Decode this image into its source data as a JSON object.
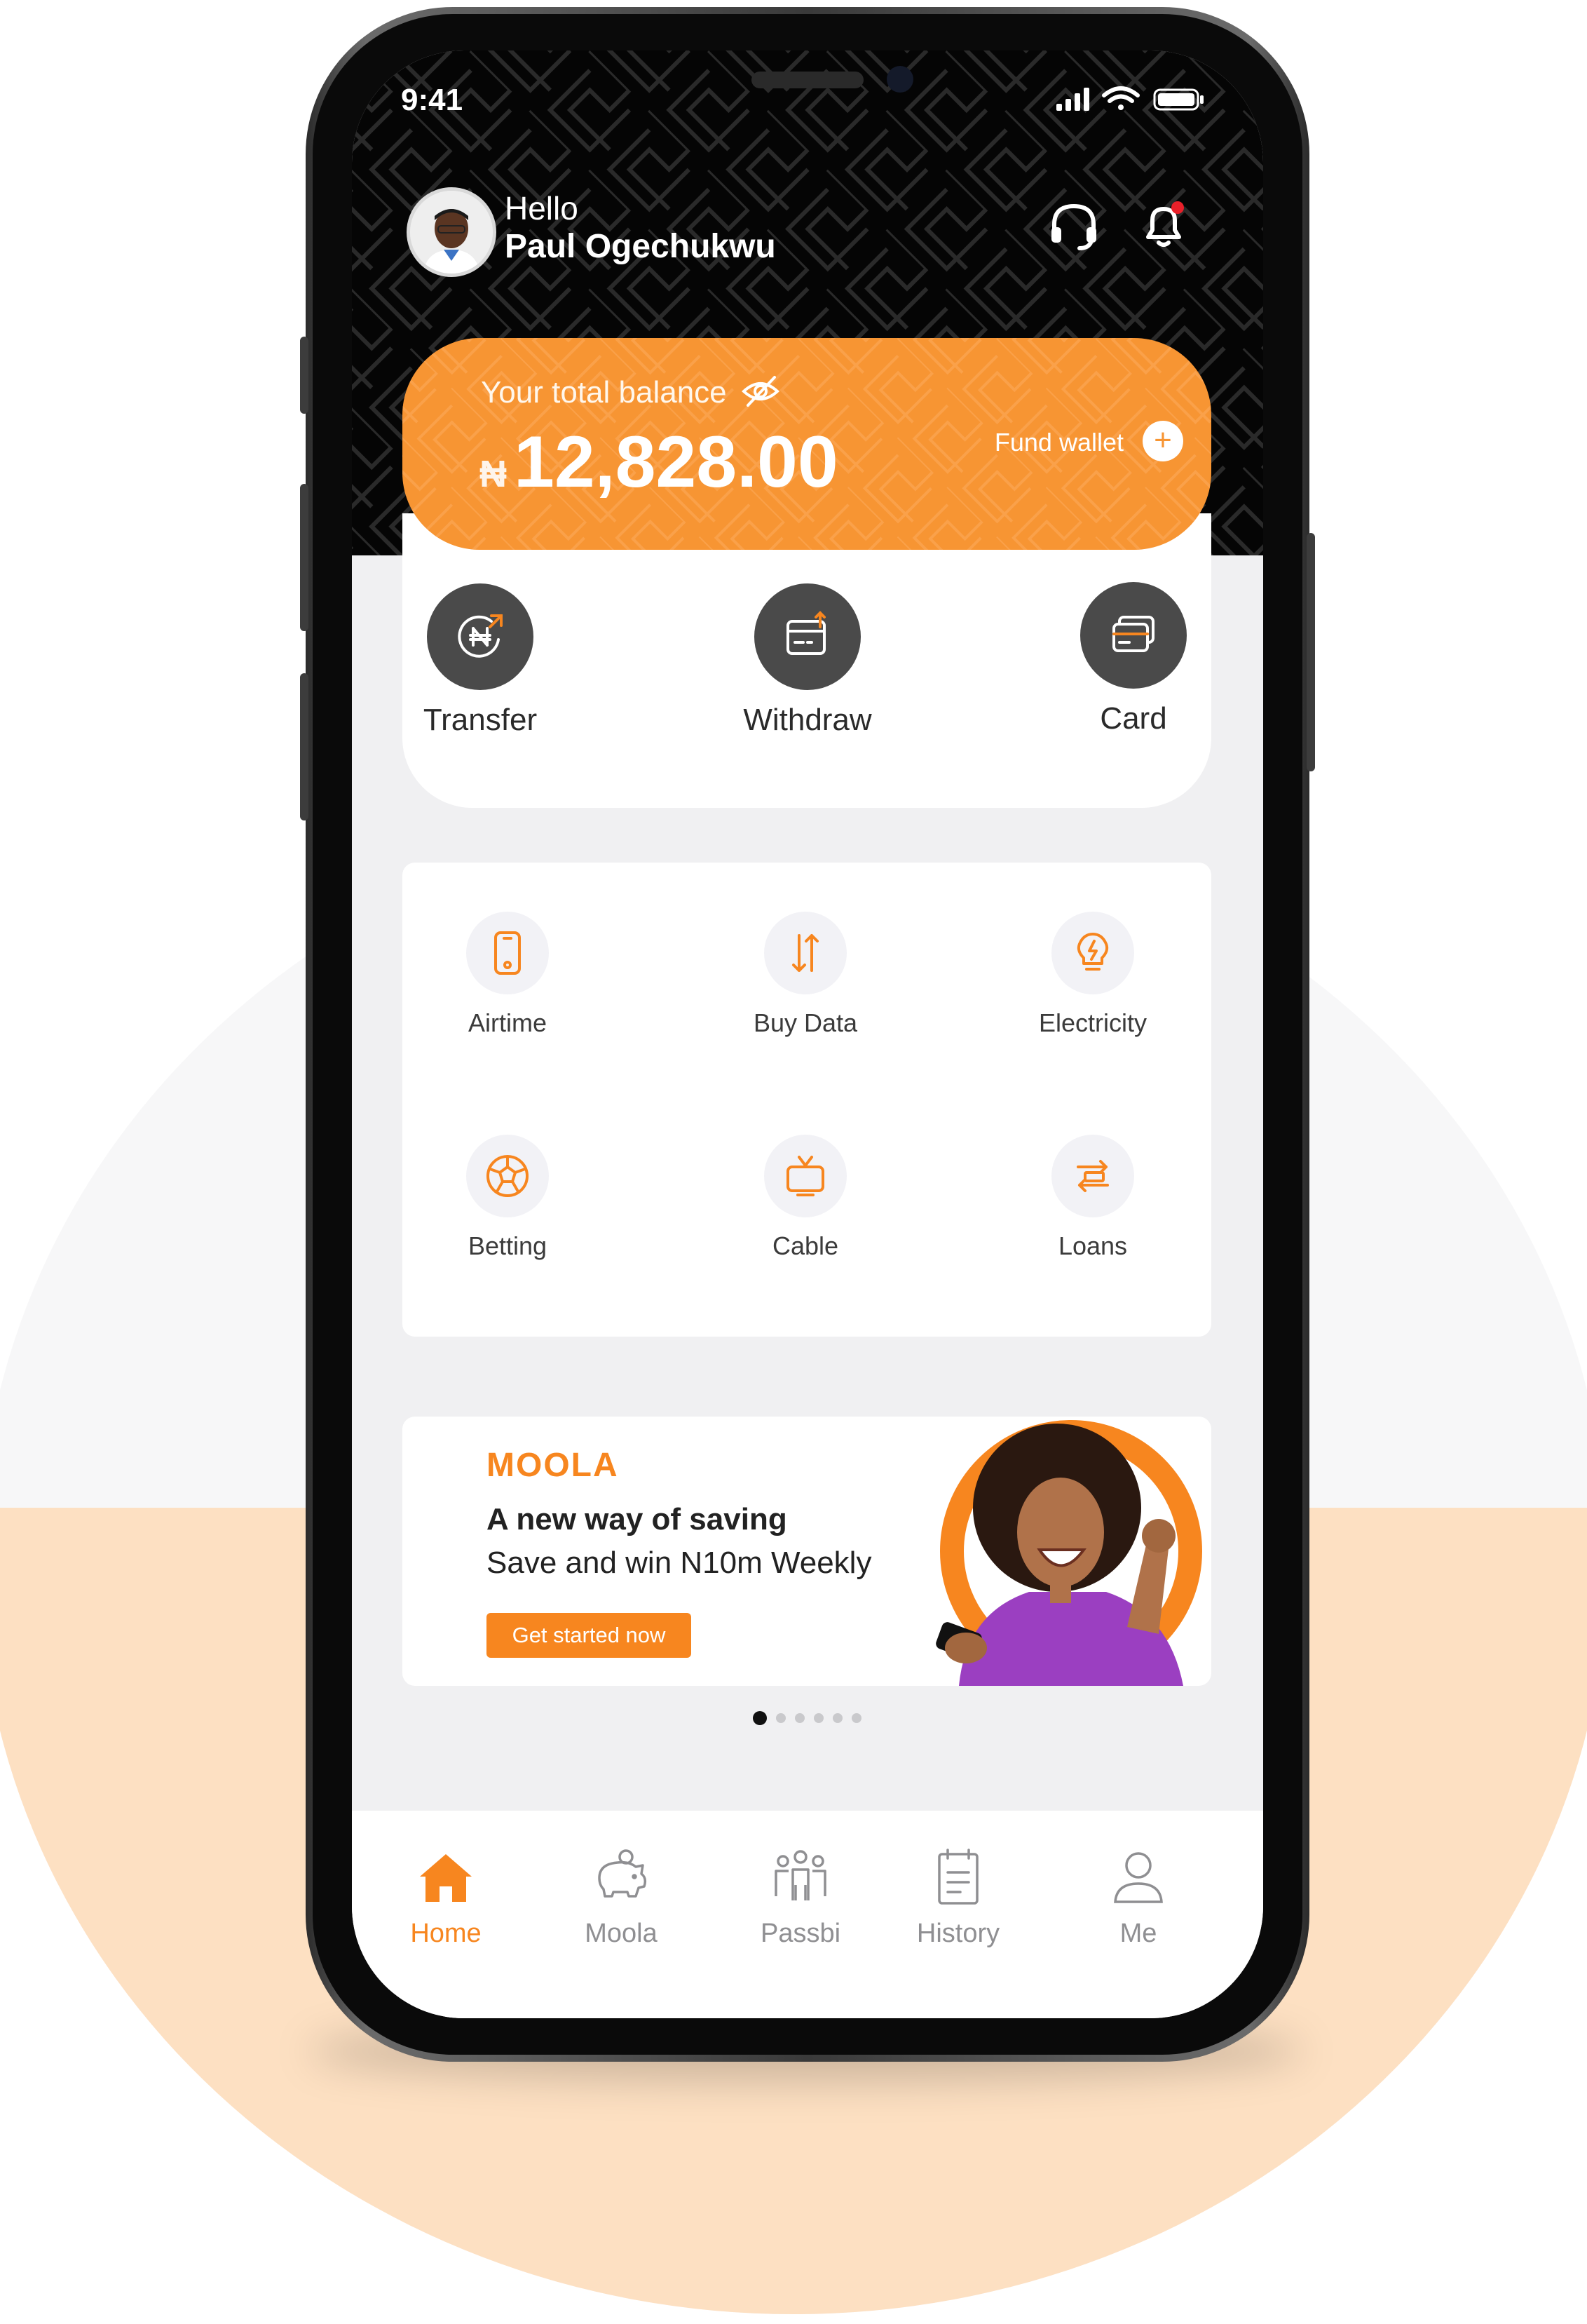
{
  "status_bar": {
    "time": "9:41"
  },
  "header": {
    "greeting": "Hello",
    "user_name": "Paul Ogechukwu"
  },
  "balance": {
    "label": "Your total balance",
    "currency": "₦",
    "amount": "12,828.00",
    "fund_label": "Fund wallet",
    "fund_plus": "+"
  },
  "quick_actions": [
    {
      "label": "Transfer",
      "icon": "transfer-naira-icon"
    },
    {
      "label": "Withdraw",
      "icon": "withdraw-icon"
    },
    {
      "label": "Card",
      "icon": "card-icon"
    }
  ],
  "services": [
    {
      "label": "Airtime",
      "icon": "phone-icon"
    },
    {
      "label": "Buy Data",
      "icon": "data-arrows-icon"
    },
    {
      "label": "Electricity",
      "icon": "bulb-icon"
    },
    {
      "label": "Betting",
      "icon": "football-icon"
    },
    {
      "label": "Cable",
      "icon": "tv-icon"
    },
    {
      "label": "Loans",
      "icon": "loan-exchange-icon"
    }
  ],
  "promo": {
    "brand": "MOOLA",
    "title": "A new way of saving",
    "subtitle": "Save and win N10m Weekly",
    "cta": "Get started now",
    "carousel_index": 1,
    "carousel_count": 6
  },
  "bottom_nav": [
    {
      "label": "Home",
      "icon": "home-icon",
      "active": true
    },
    {
      "label": "Moola",
      "icon": "piggy-bank-icon",
      "active": false
    },
    {
      "label": "Passbi",
      "icon": "group-icon",
      "active": false
    },
    {
      "label": "History",
      "icon": "clipboard-icon",
      "active": false
    },
    {
      "label": "Me",
      "icon": "user-icon",
      "active": false
    }
  ],
  "colors": {
    "accent": "#f7861f",
    "balance_card": "#f79533",
    "header_bg": "#050505",
    "action_circle": "#4a4a4a",
    "backdrop_band": "#fde0c2",
    "notification_dot": "#e8202a"
  }
}
